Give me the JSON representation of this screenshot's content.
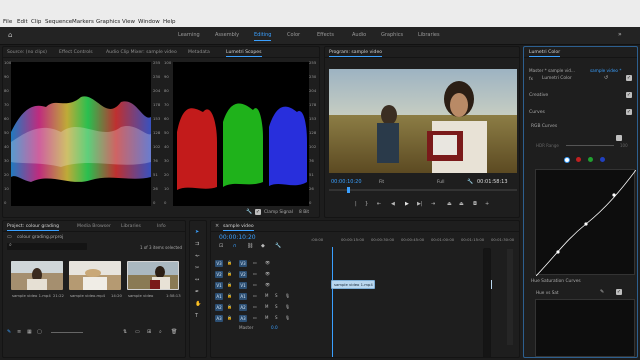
{
  "menu": [
    "File",
    "Edit",
    "Clip",
    "Sequence",
    "Markers",
    "Graphics",
    "View",
    "Window",
    "Help"
  ],
  "workspaces": [
    "Learning",
    "Assembly",
    "Editing",
    "Color",
    "Effects",
    "Audio",
    "Graphics",
    "Libraries"
  ],
  "active_workspace": "Editing",
  "source_tabs": [
    "Source: (no clips)",
    "Effect Controls",
    "Audio Clip Mixer: sample video",
    "Metadata",
    "Lumetri Scopes"
  ],
  "active_source_tab": "Lumetri Scopes",
  "scope_ticks_left": [
    "100",
    "90",
    "80",
    "70",
    "60",
    "50",
    "40",
    "30",
    "20",
    "10",
    "0"
  ],
  "scope_ticks_right": [
    "255",
    "230",
    "204",
    "178",
    "153",
    "128",
    "102",
    "76",
    "51",
    "26",
    "0"
  ],
  "scope_footer": {
    "clamp_label": "Clamp Signal",
    "bit_depth": "8 Bit"
  },
  "program": {
    "title": "Program: sample video",
    "timecode_current": "00:00:10:20",
    "fit": "Fit",
    "quality": "Full",
    "timecode_total": "00:01:58:13"
  },
  "project": {
    "tabs": [
      "Project: colour grading",
      "Media Browser",
      "Libraries",
      "Info"
    ],
    "file": "colour grading.prproj",
    "selection": "1 of 3 items selected",
    "items": [
      {
        "name": "sample video 1.mp4",
        "duration": "21:22"
      },
      {
        "name": "sample video.mp4",
        "duration": "14:20"
      },
      {
        "name": "sample video",
        "duration": "1:58:13"
      }
    ]
  },
  "timeline": {
    "tab": "sample video",
    "timecode": "00:00:10:20",
    "ruler": [
      ":00:00",
      "00:00:15:00",
      "00:00:30:00",
      "00:00:45:00",
      "00:01:00:00",
      "00:01:15:00",
      "00:01:30:00"
    ],
    "video_tracks": [
      "V3",
      "V2",
      "V1"
    ],
    "audio_tracks": [
      "A1",
      "A2",
      "A3"
    ],
    "clip_label": "sample video 1.mp4",
    "master_label": "Master",
    "master_value": "0.0"
  },
  "lumetri": {
    "title": "Lumetri Color",
    "master": "Master * sample vid...",
    "clip": "sample video *",
    "effect": "Lumetri Color",
    "sections": [
      "Creative",
      "Curves"
    ],
    "rgb_curves": "RGB Curves",
    "hdr_range": "HDR Range",
    "hdr_value": "100",
    "hue_sat": "Hue Saturation Curves",
    "hue_vs_sat": "Hue vs Sat"
  }
}
